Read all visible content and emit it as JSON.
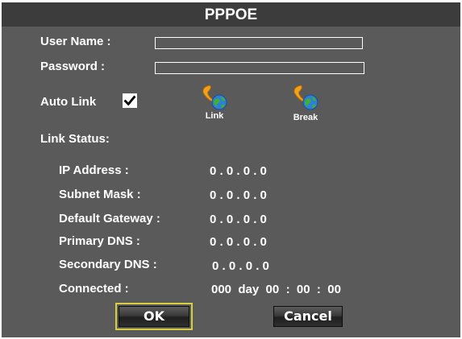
{
  "dialog": {
    "title": "PPPOE"
  },
  "form": {
    "user_name_label": "User Name :",
    "user_name_value": "",
    "password_label": "Password :",
    "password_value": "",
    "auto_link_label": "Auto Link",
    "auto_link_checked": true,
    "link_label": "Link",
    "break_label": "Break"
  },
  "status": {
    "heading": "Link Status:",
    "ip_address_label": "IP Address :",
    "ip_address_value": "0 . 0 . 0 . 0",
    "subnet_mask_label": "Subnet Mask :",
    "subnet_mask_value": "0 . 0 . 0 . 0",
    "default_gateway_label": "Default Gateway :",
    "default_gateway_value": "0 . 0 . 0 . 0",
    "primary_dns_label": "Primary DNS :",
    "primary_dns_value": "0 . 0 . 0 . 0",
    "secondary_dns_label": "Secondary DNS :",
    "secondary_dns_value": "0 . 0 . 0 . 0",
    "connected_label": "Connected :",
    "connected_value": "000  day  00  :  00  :  00"
  },
  "buttons": {
    "ok_label": "OK",
    "cancel_label": "Cancel",
    "focused": "ok"
  },
  "colors": {
    "panel_bg": "#5a5a5a",
    "titlebar_bg": "#3c3c3c",
    "focus_ring": "#d8cf3c"
  },
  "icons": {
    "link_icon": "phone-globe-icon",
    "break_icon": "phone-globe-icon"
  }
}
